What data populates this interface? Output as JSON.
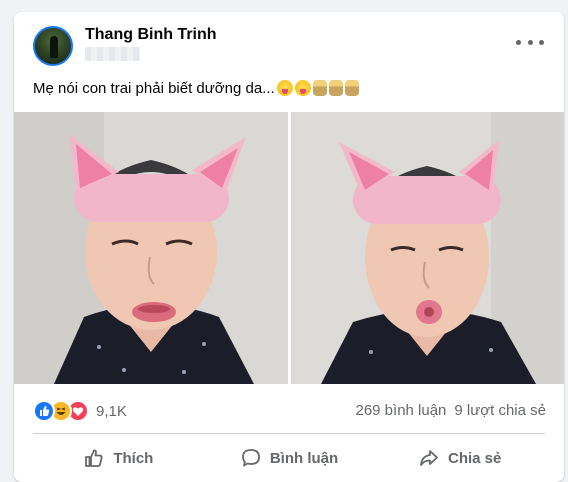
{
  "post": {
    "author": "Thang Binh Trinh",
    "caption": "Mẹ nói con trai phải biết dưỡng da...",
    "caption_emojis": [
      "tongue-emoji",
      "tongue-emoji",
      "person-emoji",
      "person-emoji",
      "person-emoji"
    ]
  },
  "reactions": {
    "icons": [
      "like-icon",
      "haha-icon",
      "love-icon"
    ],
    "count": "9,1K"
  },
  "stats": {
    "comments": "269 bình luận",
    "shares": "9 lượt chia sẻ"
  },
  "actions": {
    "like": "Thích",
    "comment": "Bình luận",
    "share": "Chia sẻ"
  },
  "colors": {
    "accent": "#1877f2",
    "secondary_text": "#65676b",
    "background": "#f0f2f5"
  }
}
